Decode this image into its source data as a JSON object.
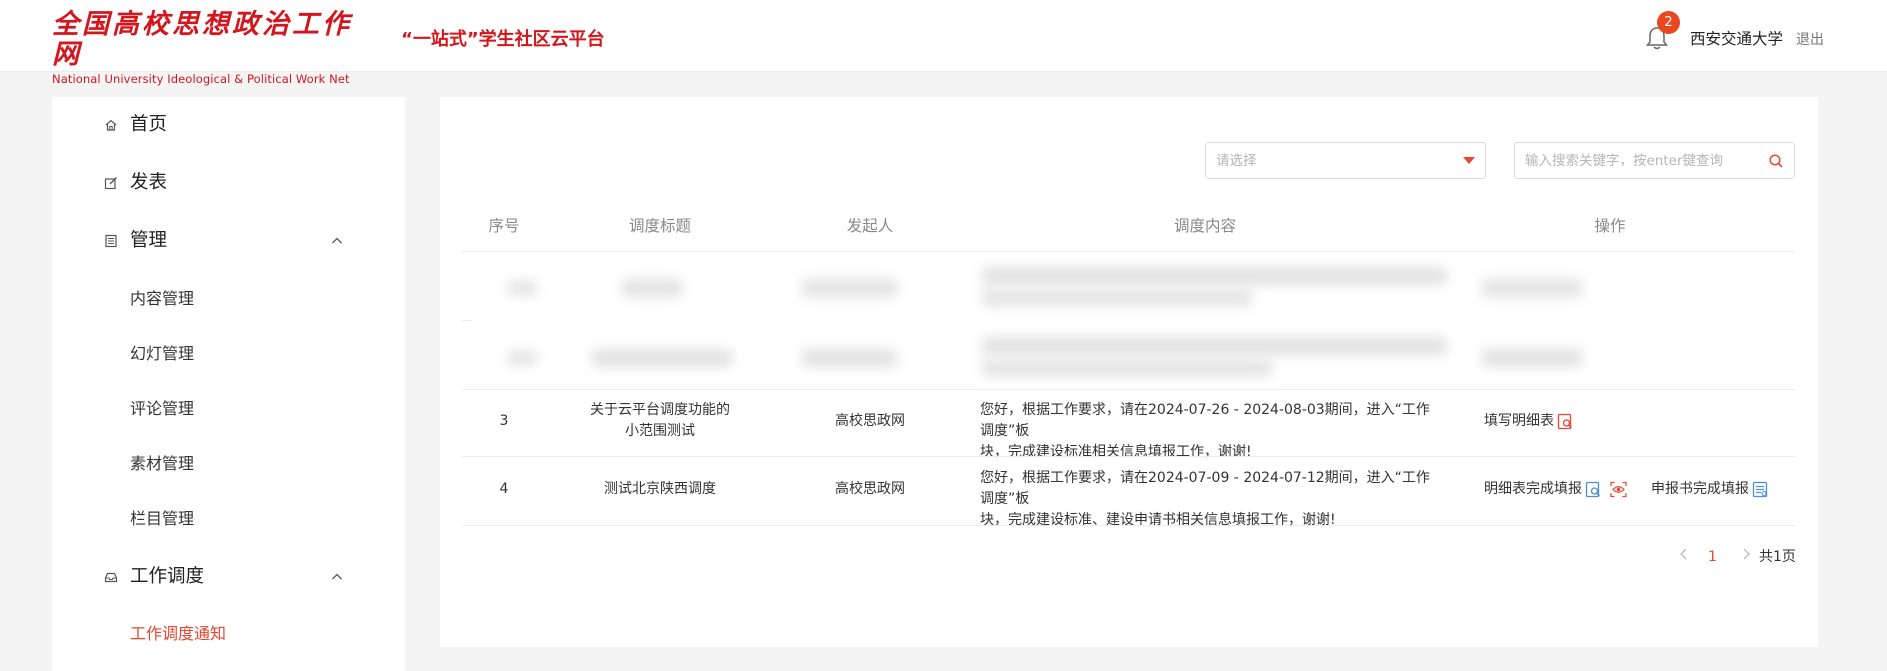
{
  "header": {
    "logo_cn": "全国高校思想政治工作网",
    "logo_en": "National University Ideological & Political Work Net",
    "platform_title": "“一站式”学生社区云平台",
    "notification_count": "2",
    "user_name": "西安交通大学",
    "logout_label": "退出"
  },
  "sidebar": {
    "home": "首页",
    "publish": "发表",
    "manage": "管理",
    "manage_items": [
      "内容管理",
      "幻灯管理",
      "评论管理",
      "素材管理",
      "栏目管理"
    ],
    "dispatch": "工作调度",
    "dispatch_items": [
      "工作调度通知"
    ]
  },
  "filters": {
    "select_placeholder": "请选择",
    "search_placeholder": "输入搜索关键字，按enter键查询"
  },
  "table": {
    "headers": [
      "序号",
      "调度标题",
      "发起人",
      "调度内容",
      "操作"
    ],
    "rows": [
      {
        "index": "3",
        "title_line1": "关于云平台调度功能的",
        "title_line2": "小范围测试",
        "initiator": "高校思政网",
        "content_line1": "您好，根据工作要求，请在2024-07-26 - 2024-08-03期间，进入“工作调度”板",
        "content_line2": "块，完成建设标准相关信息填报工作，谢谢!",
        "op1": "填写明细表"
      },
      {
        "index": "4",
        "title_line1": "测试北京陕西调度",
        "initiator": "高校思政网",
        "content_line1": "您好，根据工作要求，请在2024-07-09 - 2024-07-12期间，进入“工作调度”板",
        "content_line2": "块，完成建设标准、建设申请书相关信息填报工作，谢谢!",
        "op1": "明细表完成填报",
        "op2": "申报书完成填报"
      }
    ]
  },
  "pagination": {
    "current_page": "1",
    "total_label": "共1页"
  },
  "colors": {
    "brand_red": "#d4161c",
    "accent": "#e8462f",
    "icon_blue": "#4a90d9"
  }
}
